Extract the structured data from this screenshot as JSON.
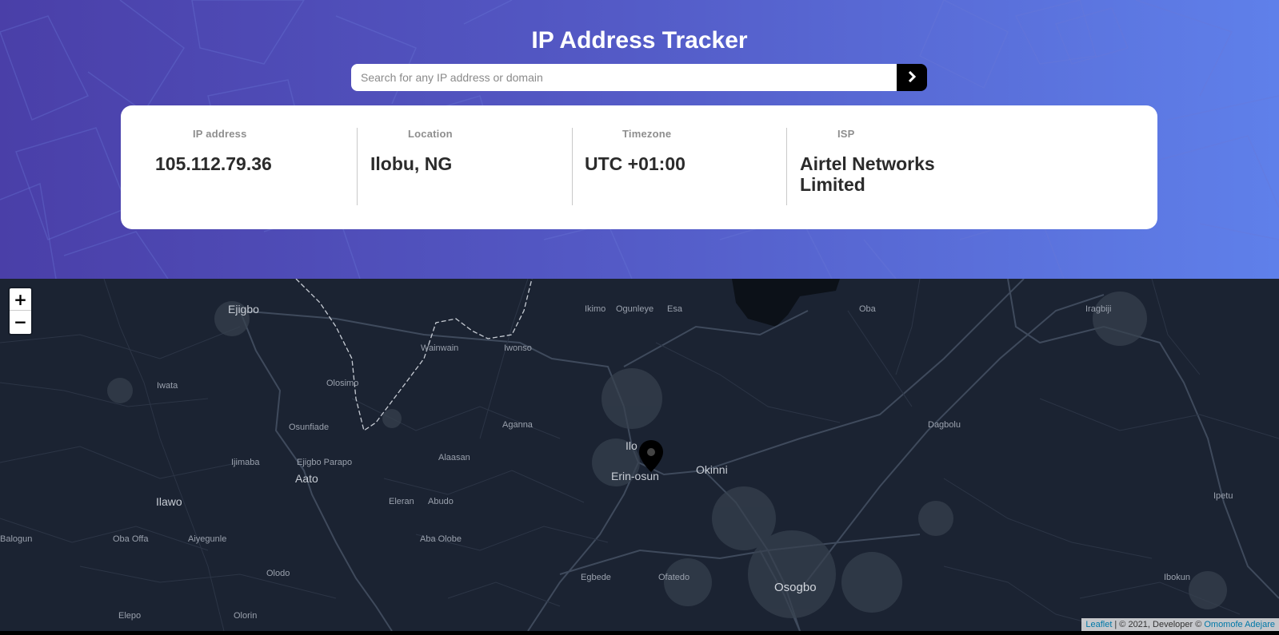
{
  "header": {
    "title": "IP Address Tracker",
    "search_placeholder": "Search for any IP address or domain",
    "search_button_icon": "chevron-right-icon"
  },
  "info": {
    "ip_label": "IP address",
    "ip_value": "105.112.79.36",
    "location_label": "Location",
    "location_value": "Ilobu, NG",
    "timezone_label": "Timezone",
    "timezone_value": "UTC +01:00",
    "isp_label": "ISP",
    "isp_value": "Airtel Networks Limited"
  },
  "map": {
    "zoom_in": "+",
    "zoom_out": "−",
    "marker_icon": "location-pin-icon",
    "labels": {
      "ejigbo": "Ejigbo",
      "ikimo": "Ikimo",
      "ogunleye": "Ogunleye",
      "esa": "Esa",
      "oba": "Oba",
      "iragbiji": "Iragbiji",
      "wainwain": "Wainwain",
      "iwonso": "Iwonso",
      "iwata": "Iwata",
      "olosimo": "Olosimo",
      "osunfiade": "Osunfiade",
      "aganna": "Aganna",
      "dagbolu": "Dagbolu",
      "ilobu": "Ilo",
      "okinni": "Okinni",
      "erinosun": "Erin-osun",
      "alaasan": "Alaasan",
      "ijimaba": "Ijimaba",
      "ejigboparapo": "Ejigbo Parapo",
      "aato": "Aato",
      "ilawo": "Ilawo",
      "eleran": "Eleran",
      "abudo": "Abudo",
      "ipetu": "Ipetu",
      "balogun": "Balogun",
      "obaoffa": "Oba Offa",
      "aiyegunle": "Aiyegunle",
      "abaolobe": "Aba Olobe",
      "olodo": "Olodo",
      "egbede": "Egbede",
      "ofatedo": "Ofatedo",
      "osogbo": "Osogbo",
      "ibokun": "Ibokun",
      "elepo": "Elepo",
      "olorin": "Olorin"
    },
    "attribution_link": "Leaflet",
    "attribution_text": "| © 2021, Developer ©",
    "attribution_author": "Omomofe Adejare"
  },
  "colors": {
    "header_gradient_start": "#4a3fa8",
    "header_gradient_end": "#5f80ea",
    "map_background": "#1b2332",
    "card_background": "#ffffff"
  }
}
